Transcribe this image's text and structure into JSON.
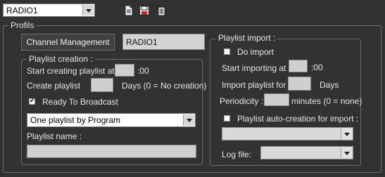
{
  "toolbar": {
    "radio_select": "RADIO1",
    "icons": [
      "new-document-icon",
      "save-icon",
      "delete-icon"
    ]
  },
  "profils": {
    "legend": "Profils",
    "channel_button": "Channel Management",
    "channel_name": "RADIO1",
    "playlist_creation": {
      "legend": "Playlist creation :",
      "start_label": "Start creating playlist at",
      "start_value": "",
      "start_suffix": ":00",
      "create_label": "Create playlist",
      "create_value": "",
      "create_suffix": "Days (0 = No creation)",
      "ready_label": "Ready To Broadcast",
      "ready_checked": true,
      "mode_select": "One playlist by Program",
      "name_label": "Playlist name :",
      "name_value": ""
    },
    "playlist_import": {
      "legend": "Playlist import :",
      "do_import_label": "Do import",
      "do_import_checked": false,
      "start_label": "Start importing at",
      "start_value": "",
      "start_suffix": ":00",
      "import_label": "Import playlist for",
      "import_value": "",
      "import_suffix": "Days",
      "periodicity_label": "Periodicity :",
      "periodicity_value": "",
      "periodicity_suffix": "minutes (0 = none)",
      "auto_creation_label": "Playlist auto-creation for import :",
      "auto_creation_checked": false,
      "auto_creation_select": "",
      "log_label": "Log file:",
      "log_select": ""
    }
  }
}
